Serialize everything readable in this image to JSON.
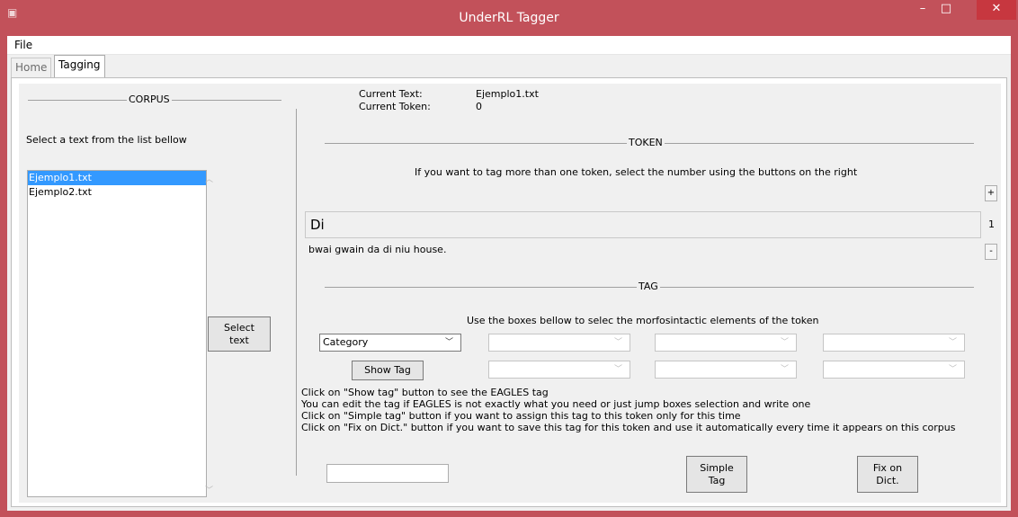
{
  "window": {
    "title": "UnderRL Tagger",
    "minimize_glyph": "–",
    "maximize_glyph": "□",
    "close_glyph": "✕"
  },
  "menu": {
    "file_label": "File"
  },
  "tabs": [
    {
      "label": "Home",
      "selected": false
    },
    {
      "label": "Tagging",
      "selected": true
    }
  ],
  "corpus": {
    "header": "CORPUS",
    "instruction": "Select a text from the list bellow",
    "files": [
      "Ejemplo1.txt",
      "Ejemplo2.txt"
    ],
    "selected_index": 0,
    "select_button": "Select\ntext"
  },
  "status": {
    "current_text_label": "Current Text:",
    "current_text_value": "Ejemplo1.txt",
    "current_token_label": "Current Token:",
    "current_token_value": "0"
  },
  "token": {
    "header": "TOKEN",
    "instruction": "If you want to tag more than one token, select the number using the buttons on the right",
    "value": "Di",
    "context": "bwai gwain da di niu house.",
    "count": "1",
    "plus_label": "+",
    "minus_label": "-"
  },
  "tag": {
    "header": "TAG",
    "instruction": "Use the boxes bellow to selec the morfosintactic elements of the token",
    "category_value": "Category",
    "show_tag_button": "Show Tag",
    "help_lines": [
      "Click on \"Show tag\" button to see the EAGLES tag",
      "You can edit the tag if EAGLES is not exactly what you need or just jump boxes selection and write one",
      "Click on \"Simple tag\" button if you want to assign this tag to this token only for this time",
      "Click on \"Fix on Dict.\" button if you want to save this tag for this token and use it automatically every time it appears on this corpus"
    ],
    "tag_input_value": "",
    "simple_tag_button": "Simple\nTag",
    "fix_dict_button": "Fix on\nDict."
  },
  "colors": {
    "titlebar": "#c2515a",
    "close_button": "#c7373f",
    "selection": "#3399ff",
    "panel": "#f0f0f0"
  }
}
